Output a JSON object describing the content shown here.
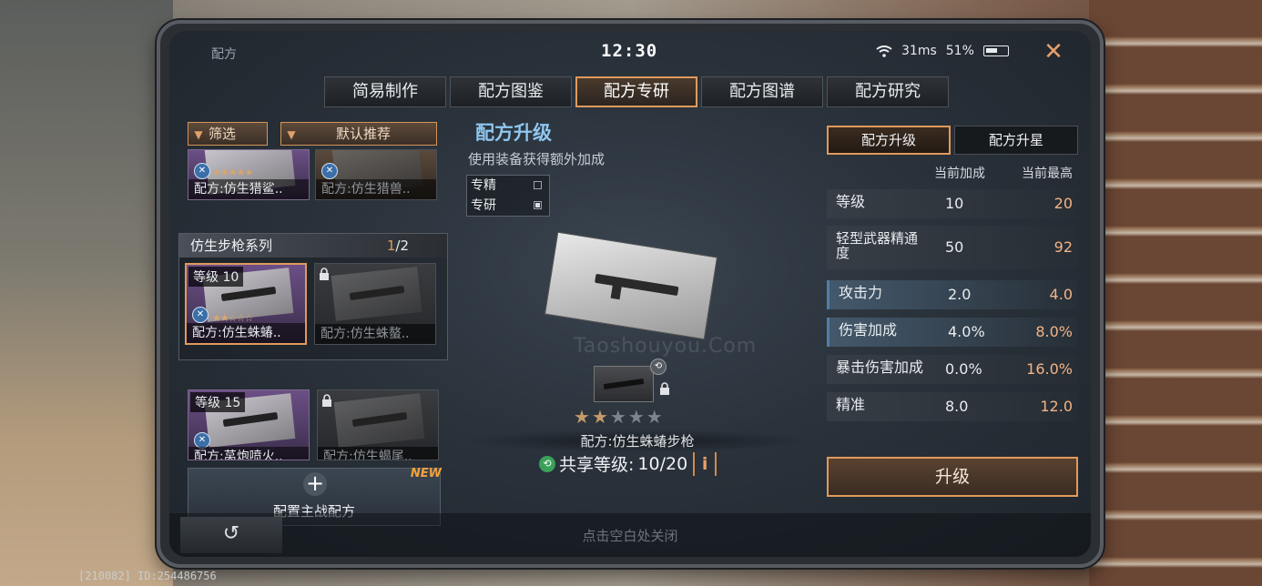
{
  "window": {
    "title": "配方",
    "time": "12:30",
    "ping": "31ms",
    "battery": "51%"
  },
  "tabs": [
    {
      "label": "简易制作"
    },
    {
      "label": "配方图鉴"
    },
    {
      "label": "配方专研"
    },
    {
      "label": "配方图谱"
    },
    {
      "label": "配方研究"
    }
  ],
  "filters": {
    "filter": "筛选",
    "sort": "默认推荐"
  },
  "top_cards": [
    {
      "label": "配方:仿生猎鲨.."
    },
    {
      "label": "配方:仿生猎兽.."
    }
  ],
  "series": {
    "title": "仿生步枪系列",
    "page_current": "1",
    "page_total": "/2",
    "cards": [
      {
        "level": "等级 10",
        "label": "配方:仿生蛛蝽.."
      },
      {
        "label": "配方:仿生蛛螯.."
      }
    ]
  },
  "series2_cards": [
    {
      "level": "等级 15",
      "label": "配方:莴炮喷火.."
    },
    {
      "label": "配方:仿生蝎尾.."
    }
  ],
  "main_config": {
    "label": "配置主战配方",
    "new_badge": "NEW"
  },
  "center": {
    "title": "配方升级",
    "subtitle": "使用装备获得额外加成",
    "modes": [
      {
        "label": "专精",
        "checked": false
      },
      {
        "label": "专研",
        "checked": true
      }
    ],
    "stars_filled": 2,
    "stars_total": 5,
    "recipe_name": "配方:仿生蛛蝽步枪",
    "share_label": "共享等级:",
    "share_value": "10/20",
    "info_label": "i",
    "watermark": "Taoshouyou.Com"
  },
  "right": {
    "tabs": [
      {
        "label": "配方升级"
      },
      {
        "label": "配方升星"
      }
    ],
    "col_current": "当前加成",
    "col_max": "当前最高",
    "stats": [
      {
        "name": "等级",
        "current": "10",
        "max": "20"
      },
      {
        "name": "轻型武器精通度",
        "current": "50",
        "max": "92"
      },
      {
        "name": "攻击力",
        "current": "2.0",
        "max": "4.0"
      },
      {
        "name": "伤害加成",
        "current": "4.0%",
        "max": "8.0%"
      },
      {
        "name": "暴击伤害加成",
        "current": "0.0%",
        "max": "16.0%"
      },
      {
        "name": "精准",
        "current": "8.0",
        "max": "12.0"
      }
    ],
    "upgrade_label": "升级"
  },
  "bottom": {
    "hint": "点击空白处关闭",
    "back": "↺"
  },
  "footer_id": "[210082] ID:254486756",
  "colors": {
    "accent": "#e09a5c",
    "title_blue": "#8fc6ef",
    "value_orange": "#f2b487"
  }
}
